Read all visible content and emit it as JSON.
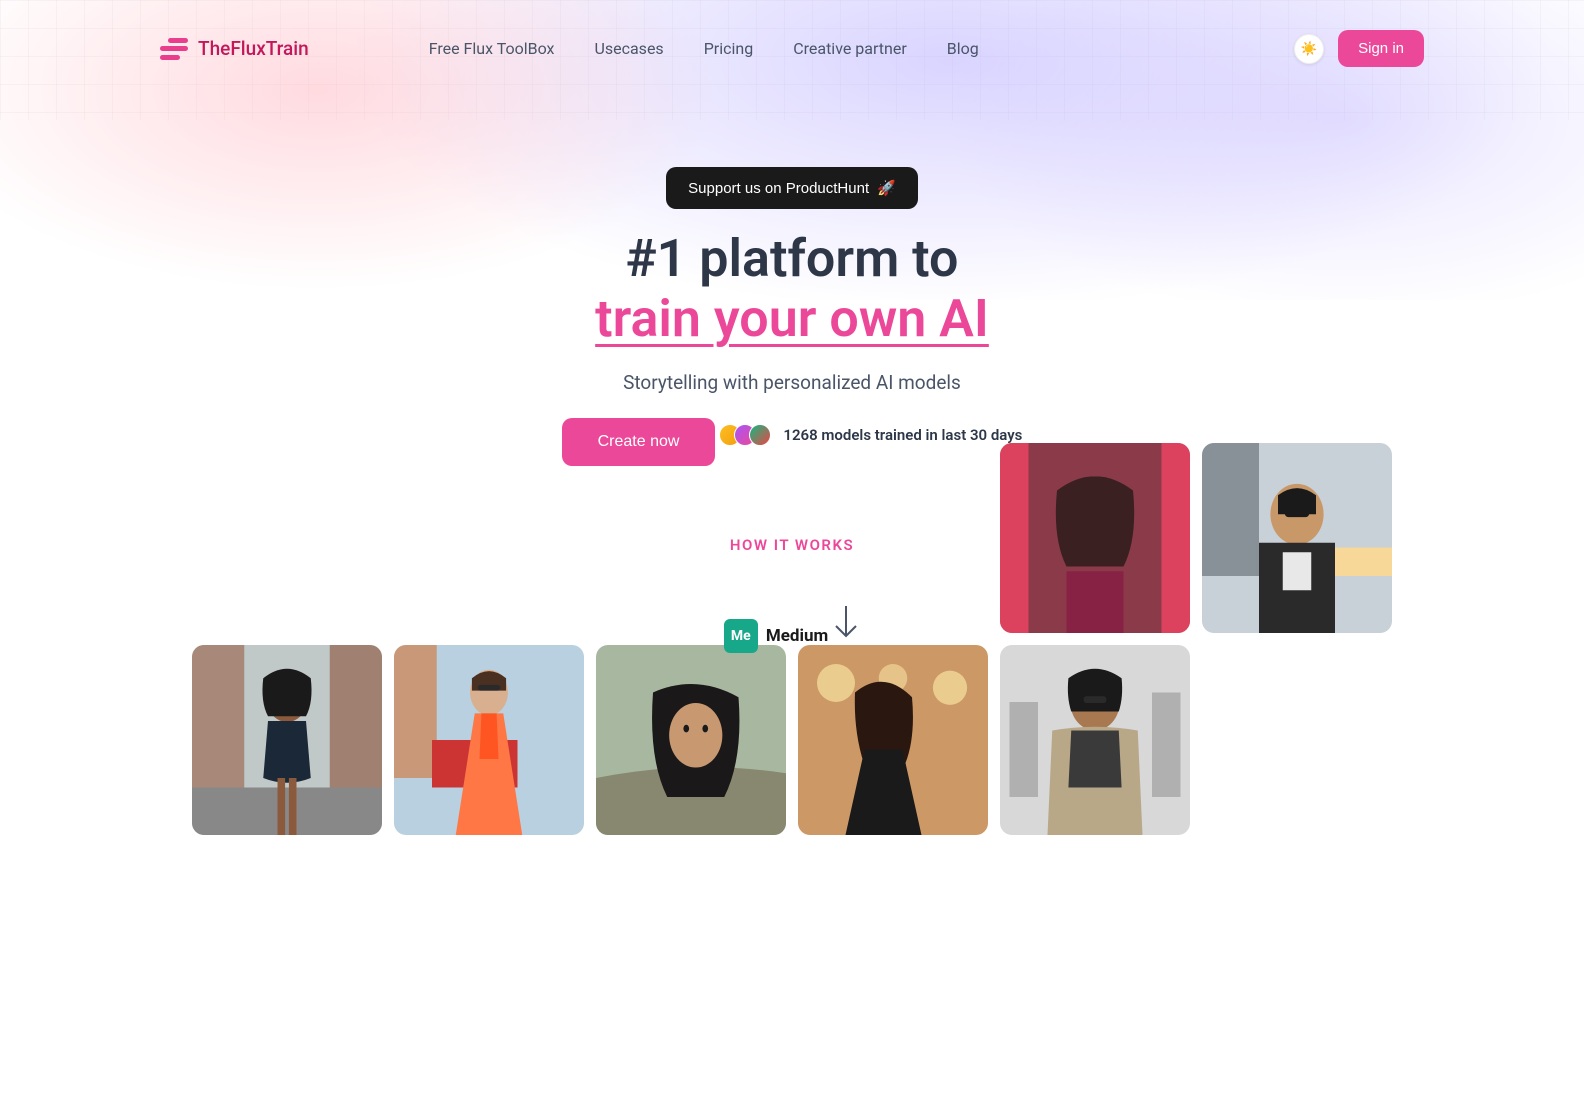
{
  "brand": "TheFluxTrain",
  "nav": {
    "items": [
      "Free Flux ToolBox",
      "Usecases",
      "Pricing",
      "Creative partner",
      "Blog"
    ]
  },
  "header": {
    "sign_in": "Sign in"
  },
  "hero": {
    "ph_label": "Support us on ProductHunt",
    "title_line1": "#1 platform to",
    "title_line2": "train your own AI",
    "subtitle": "Storytelling with personalized AI models",
    "cta": "Create now",
    "stats_text": "1268 models trained in last 30 days"
  },
  "how": {
    "title": "HOW IT WORKS",
    "medium_label": "Medium",
    "medium_short": "Me"
  },
  "colors": {
    "accent": "#ec4899",
    "dark": "#2d3748"
  }
}
